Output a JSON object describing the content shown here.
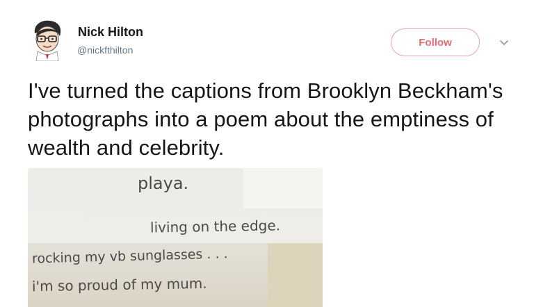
{
  "author": {
    "name": "Nick Hilton",
    "handle": "@nickfthilton"
  },
  "follow_label": "Follow",
  "tweet_text": "I've turned the captions from Brooklyn Beckham's photographs into a poem about the emptiness of wealth and celebrity.",
  "photo": {
    "lines": [
      "playa.",
      "living on the edge.",
      "rocking my vb sunglasses . . .",
      "i'm so proud of my mum."
    ]
  },
  "colors": {
    "follow_accent": "#e06c75",
    "name": "#14171a",
    "handle": "#657786"
  },
  "icons": {
    "avatar": "cartoon-avatar",
    "menu": "chevron-down-icon"
  }
}
